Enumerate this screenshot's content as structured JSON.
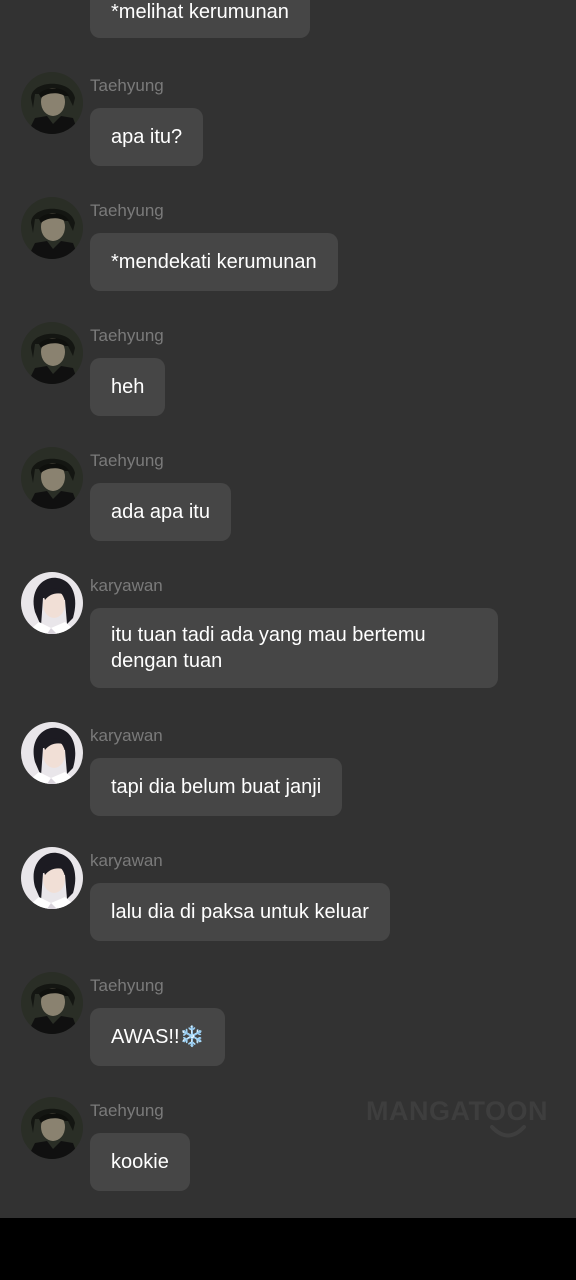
{
  "chat": {
    "top_message": "*melihat kerumunan",
    "messages": [
      {
        "sender": "Taehyung",
        "text": "apa itu?"
      },
      {
        "sender": "Taehyung",
        "text": "*mendekati kerumunan"
      },
      {
        "sender": "Taehyung",
        "text": "heh"
      },
      {
        "sender": "Taehyung",
        "text": "ada apa itu"
      },
      {
        "sender": "karyawan",
        "text": "itu tuan tadi ada yang mau bertemu dengan tuan"
      },
      {
        "sender": "karyawan",
        "text": "tapi dia belum buat janji"
      },
      {
        "sender": "karyawan",
        "text": "lalu dia di paksa untuk keluar"
      },
      {
        "sender": "Taehyung",
        "text": "AWAS!!❄️"
      },
      {
        "sender": "Taehyung",
        "text": "kookie"
      }
    ]
  },
  "watermark": "MANGATOON",
  "colors": {
    "background": "#323232",
    "bubble": "#464646",
    "sender_name": "#7a7a7a",
    "text": "#ffffff",
    "snowflake": "#4aa3df"
  },
  "icons": {
    "taehyung_avatar": "avatar-taehyung",
    "karyawan_avatar": "avatar-karyawan"
  }
}
